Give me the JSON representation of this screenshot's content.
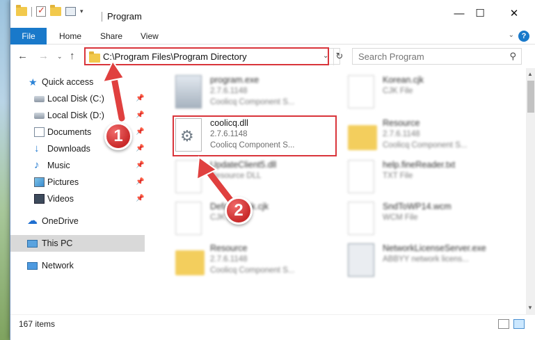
{
  "window": {
    "title": "Program",
    "controls": {
      "minimize": "—",
      "maximize": "☐",
      "close": "✕"
    }
  },
  "ribbon": {
    "tabs": [
      {
        "label": "File"
      },
      {
        "label": "Home"
      },
      {
        "label": "Share"
      },
      {
        "label": "View"
      }
    ],
    "help": "?"
  },
  "address": {
    "path": "C:\\Program Files\\Program Directory",
    "search_placeholder": "Search Program"
  },
  "sidebar": {
    "items": [
      {
        "label": "Quick access",
        "icon": "star-icon",
        "pinned": false
      },
      {
        "label": "Local Disk (C:)",
        "icon": "drive-icon",
        "pinned": true
      },
      {
        "label": "Local Disk (D:)",
        "icon": "drive-icon",
        "pinned": true
      },
      {
        "label": "Documents",
        "icon": "documents-icon",
        "pinned": true
      },
      {
        "label": "Downloads",
        "icon": "download-icon",
        "pinned": true
      },
      {
        "label": "Music",
        "icon": "music-icon",
        "pinned": true
      },
      {
        "label": "Pictures",
        "icon": "pictures-icon",
        "pinned": true
      },
      {
        "label": "Videos",
        "icon": "videos-icon",
        "pinned": true
      },
      {
        "label": "OneDrive",
        "icon": "cloud-icon",
        "pinned": false
      },
      {
        "label": "This PC",
        "icon": "computer-icon",
        "pinned": false
      },
      {
        "label": "Network",
        "icon": "network-icon",
        "pinned": false
      }
    ]
  },
  "files": [
    {
      "name": "program.exe",
      "line1": "2.7.6.1148",
      "line2": "Coolicq Component S...",
      "icon": "exe-icon",
      "blurred": true
    },
    {
      "name": "Korean.cjk",
      "line1": "CJK File",
      "line2": "",
      "icon": "file-icon",
      "blurred": true
    },
    {
      "name": "coolicq.dll",
      "line1": "2.7.6.1148",
      "line2": "Coolicq Component S...",
      "icon": "dll-gear-icon",
      "blurred": false
    },
    {
      "name": "Resource",
      "line1": "2.7.6.1148",
      "line2": "Coolicq Component S...",
      "icon": "folder-icon",
      "blurred": true
    },
    {
      "name": "UpdateClient5.dll",
      "line1": "Resource DLL",
      "line2": "",
      "icon": "file-icon",
      "blurred": true
    },
    {
      "name": "help.fineReader.txt",
      "line1": "TXT File",
      "line2": "",
      "icon": "file-icon",
      "blurred": true
    },
    {
      "name": "DefaultTask.cjk",
      "line1": "CJK File",
      "line2": "",
      "icon": "file-icon",
      "blurred": true
    },
    {
      "name": "SndToWP14.wcm",
      "line1": "WCM File",
      "line2": "",
      "icon": "file-icon",
      "blurred": true
    },
    {
      "name": "Resource",
      "line1": "2.7.6.1148",
      "line2": "Coolicq Component S...",
      "icon": "folder-icon",
      "blurred": true
    },
    {
      "name": "NetworkLicenseServer.exe",
      "line1": "ABBYY network licens...",
      "line2": "",
      "icon": "network-exe-icon",
      "blurred": true
    }
  ],
  "annotations": {
    "step1": "1",
    "step2": "2",
    "highlight_color": "#d9343a"
  },
  "status": {
    "item_count": "167 items"
  }
}
